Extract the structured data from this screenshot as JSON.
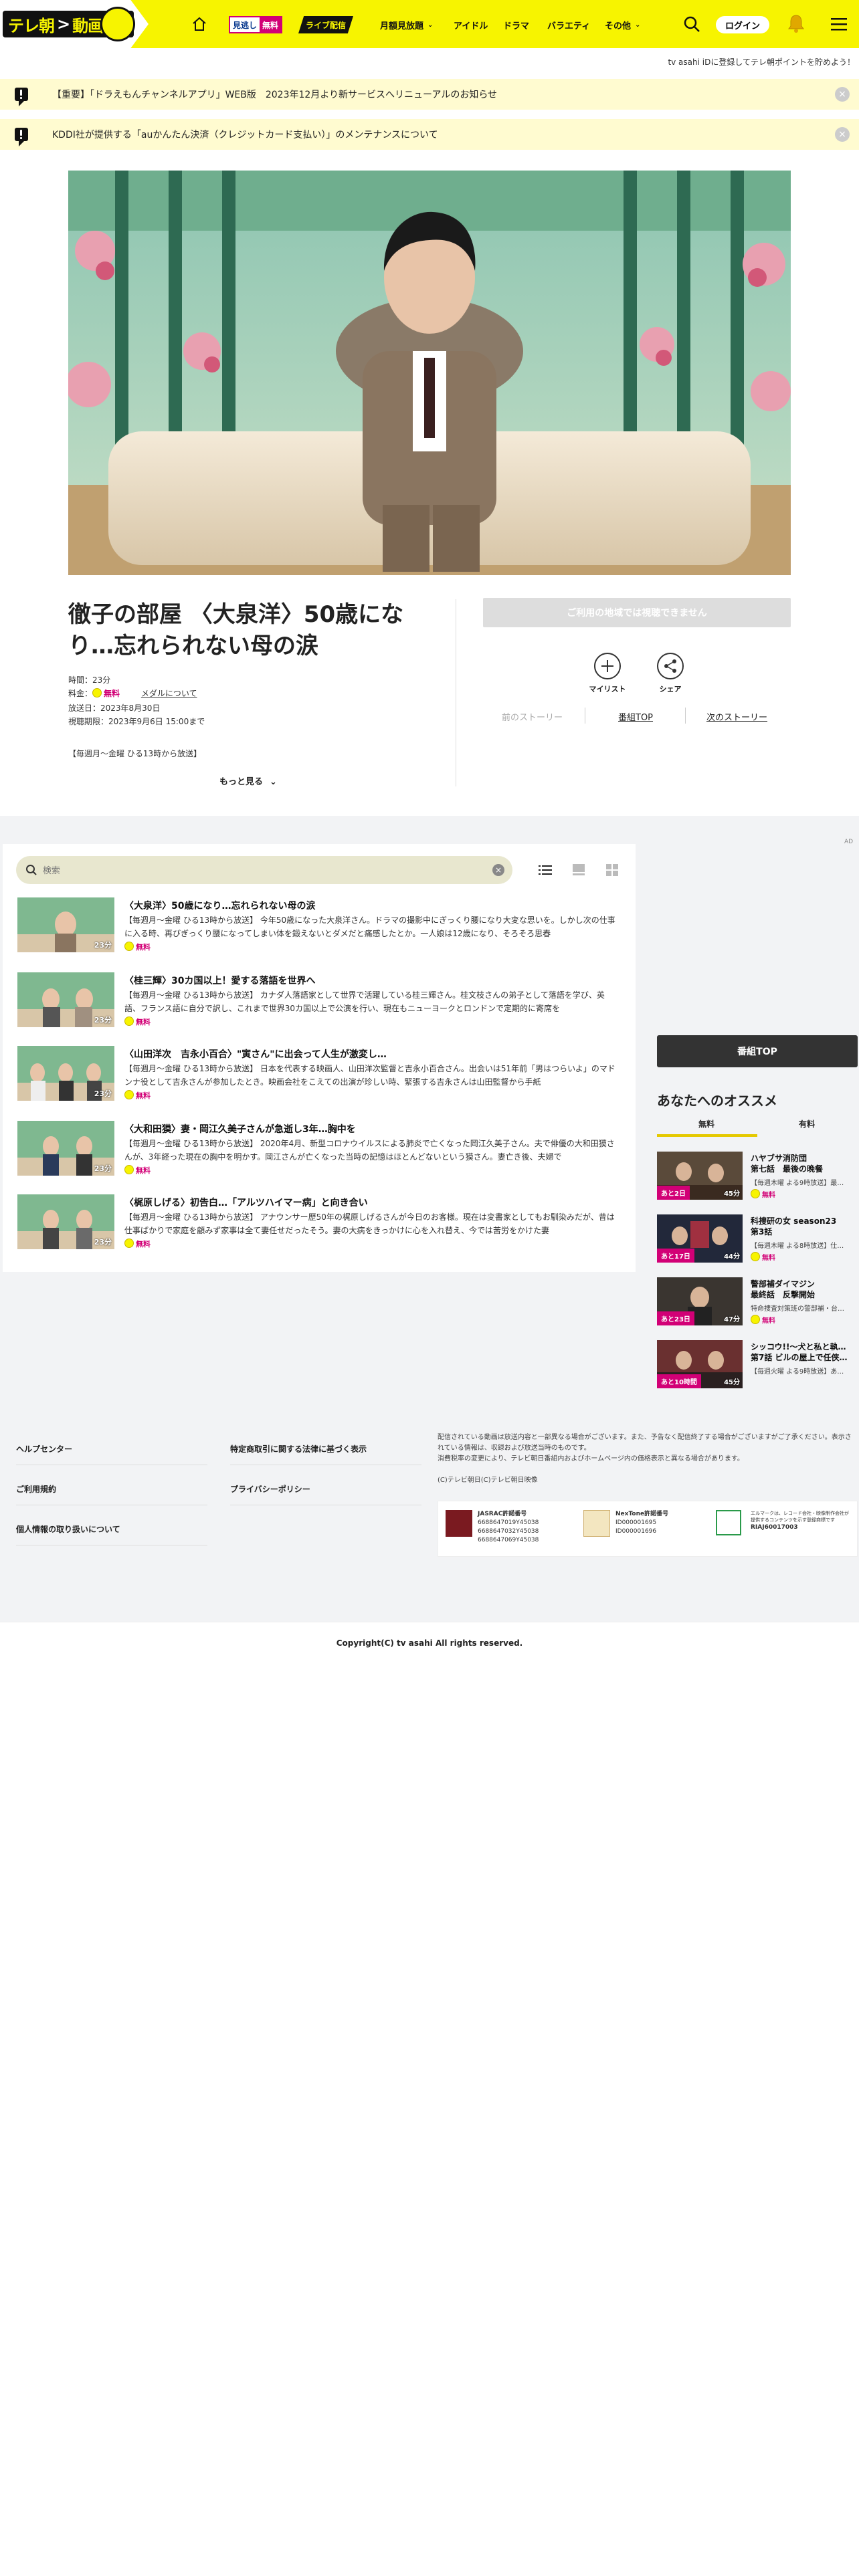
{
  "header": {
    "logo_text_left": "テレ朝",
    "logo_text_right": "動画",
    "mitaore_a": "見逃し",
    "mitaore_b": "無料",
    "live_label": "ライブ配信",
    "nav": [
      {
        "label": "月額見放題"
      },
      {
        "label": "アイドル"
      },
      {
        "label": "ドラマ"
      },
      {
        "label": "バラエティ"
      },
      {
        "label": "その他"
      }
    ],
    "login_label": "ログイン",
    "register_text": "tv asahi iDに登録してテレ朝ポイントを貯めよう！"
  },
  "notices": [
    {
      "text": "【重要】「ドラえもんチャンネルアプリ」WEB版　2023年12月より新サービスへリニューアルのお知らせ"
    },
    {
      "text": "KDDI社が提供する「auかんたん決済（クレジットカード支払い）」のメンテナンスについて"
    }
  ],
  "episode": {
    "title": "徹子の部屋 〈大泉洋〉50歳になり…忘れられない母の涙",
    "duration": "時間：23分",
    "fee_label": "料金：",
    "fee_value": "無料",
    "media_link": "メダルについて",
    "air_date": "放送日：2023年8月30日",
    "expiry": "視聴期限：2023年9月6日 15:00まで",
    "broadcast": "【毎週月～金曜 ひる13時から放送】",
    "more_label": "もっと見る",
    "unavailable_label": "ご利用の地域では視聴できません",
    "mylist_label": "マイリスト",
    "share_label": "シェア",
    "prev_label": "前のストーリー",
    "top_label": "番組TOP",
    "next_label": "次のストーリー"
  },
  "list": {
    "search_placeholder": "検索",
    "free_label": "無料",
    "episodes": [
      {
        "title": "〈大泉洋〉50歳になり…忘れられない母の涙",
        "desc": "【毎週月～金曜 ひる13時から放送】 今年50歳になった大泉洋さん。ドラマの撮影中にぎっくり腰になり大変な思いを。しかし次の仕事に入る時、再びぎっくり腰になってしまい体を鍛えないとダメだと痛感したとか。一人娘は12歳になり、そろそろ思春",
        "dur": "23分"
      },
      {
        "title": "〈桂三輝〉30カ国以上！愛する落語を世界へ",
        "desc": "【毎週月～金曜 ひる13時から放送】 カナダ人落語家として世界で活躍している桂三輝さん。桂文枝さんの弟子として落語を学び、英語、フランス語に自分で訳し、これまで世界30カ国以上で公演を行い、現在もニューヨークとロンドンで定期的に寄席を",
        "dur": "23分"
      },
      {
        "title": "〈山田洋次　吉永小百合〉\"寅さん\"に出会って人生が激変し…",
        "desc": "【毎週月～金曜 ひる13時から放送】 日本を代表する映画人、山田洋次監督と吉永小百合さん。出会いは51年前「男はつらいよ」のマドンナ役として吉永さんが参加したとき。映画会社をこえての出演が珍しい時、緊張する吉永さんは山田監督から手紙",
        "dur": "23分"
      },
      {
        "title": "〈大和田獏〉妻・岡江久美子さんが急逝し3年…胸中を",
        "desc": "【毎週月～金曜 ひる13時から放送】 2020年4月、新型コロナウイルスによる肺炎で亡くなった岡江久美子さん。夫で俳優の大和田獏さんが、3年経った現在の胸中を明かす。岡江さんが亡くなった当時の記憶はほとんどないという獏さん。妻亡き後、夫婦で",
        "dur": "23分"
      },
      {
        "title": "〈梶原しげる〉初告白…「アルツハイマー病」と向き合い",
        "desc": "【毎週月～金曜 ひる13時から放送】 アナウンサー歴50年の梶原しげるさんが今日のお客様。現在は変書家としてもお馴染みだが、昔は仕事ばかりで家庭を顧みず家事は全て妻任せだったそう。妻の大病をきっかけに心を入れ替え、今では苦労をかけた妻",
        "dur": "23分"
      }
    ]
  },
  "sidebar": {
    "ad_label": "AD",
    "top_button": "番組TOP",
    "rec_title": "あなたへのオススメ",
    "tab_free": "無料",
    "tab_paid": "有料",
    "free_label": "無料",
    "items": [
      {
        "badge": "あと2日",
        "dur": "45分",
        "title": "ハヤブサ消防団\n第七話　最後の晩餐",
        "desc": "【毎週木曜 よる9時放送】最…"
      },
      {
        "badge": "あと17日",
        "dur": "44分",
        "title": "科捜研の女 season23\n第3話",
        "desc": "【毎週木曜 よる8時放送】仕…"
      },
      {
        "badge": "あと23日",
        "dur": "47分",
        "title": "警部補ダイマジン\n最終話　反撃開始",
        "desc": "特命捜査対策班の警部補・台…"
      },
      {
        "badge": "あと10時間",
        "dur": "45分",
        "title": "シッコウ!!～犬と私と執…\n第7話 ビルの屋上で任侠…",
        "desc": "【毎週火曜 よる9時放送】あ…"
      }
    ]
  },
  "footer": {
    "links_left": [
      "ヘルプセンター",
      "ご利用規約",
      "個人情報の取り扱いについて"
    ],
    "links_right": [
      "特定商取引に関する法律に基づく表示",
      "プライバシーポリシー"
    ],
    "note1": "配信されている動画は放送内容と一部異なる場合がございます。また、予告なく配信終了する場合がございますがご了承ください。表示されている情報は、収録および放送当時のものです。",
    "note2": "消費税率の変更により、テレビ朝日番組内およびホームページ内の価格表示と異なる場合があります。",
    "note3": "(C)テレビ朝日(C)テレビ朝日映像",
    "jasrac_title": "JASRAC許諾番号",
    "jasrac_nums": "6688647019Y45038\n6688647032Y45038\n6688647069Y45038",
    "nextone_title": "NexTone許諾番号",
    "nextone_nums": "ID000001695\nID000001696",
    "lmark_text": "エルマークは、レコード会社・映像制作会社が提供するコンテンツを示す登録商標です",
    "lmark_num": "RIAJ60017003",
    "copyright": "Copyright(C) tv asahi All rights reserved."
  }
}
